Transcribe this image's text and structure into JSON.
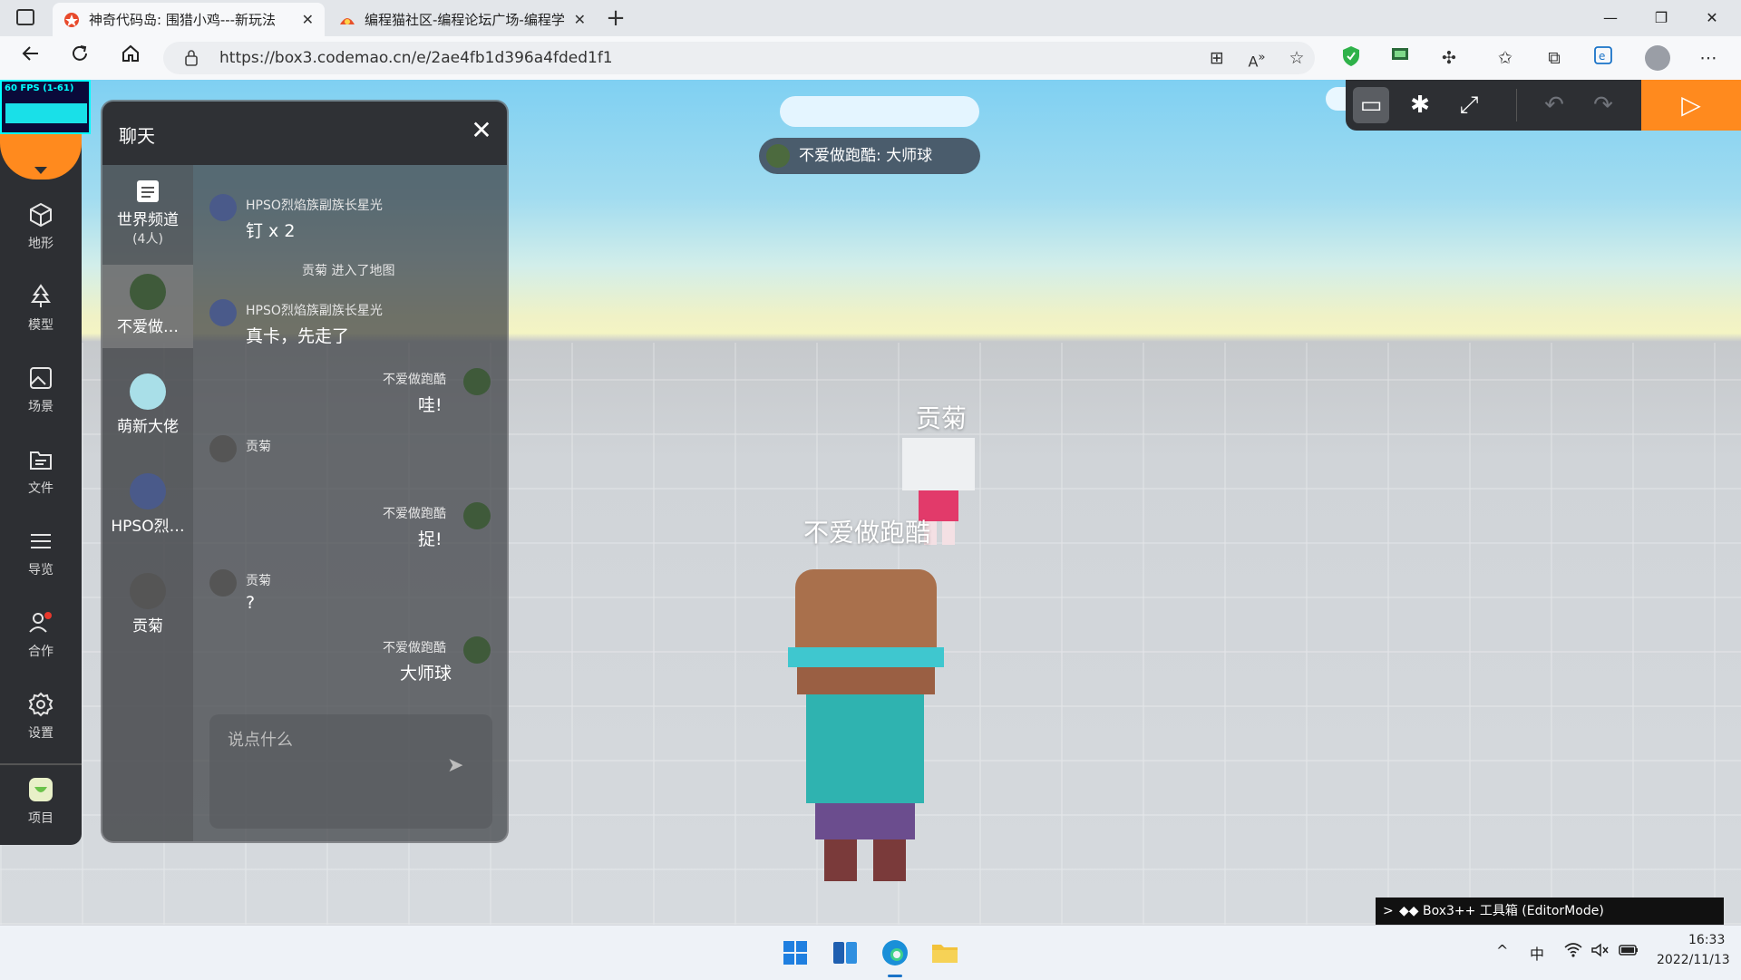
{
  "browser": {
    "tabs": [
      {
        "label": "神奇代码岛: 围猎小鸡---新玩法",
        "close": "✕",
        "icon": "codemao-island-icon"
      },
      {
        "label": "编程猫社区-编程论坛广场-编程学",
        "close": "✕",
        "icon": "codemao-community-icon"
      }
    ],
    "new_tab": "+",
    "url": "https://box3.codemao.cn/e/2ae4fb1d396a4fded1f1",
    "window_controls": {
      "minimize": "—",
      "restore": "❐",
      "close": "✕"
    }
  },
  "fps_meter": {
    "label": "60 FPS (1-61)"
  },
  "sidebar": {
    "items": [
      {
        "label": "地形",
        "icon": "cube-icon"
      },
      {
        "label": "模型",
        "icon": "tree-icon"
      },
      {
        "label": "场景",
        "icon": "image-icon"
      },
      {
        "label": "文件",
        "icon": "file-icon"
      },
      {
        "label": "导览",
        "icon": "list-icon"
      },
      {
        "label": "合作",
        "icon": "users-icon"
      },
      {
        "label": "设置",
        "icon": "gear-icon"
      },
      {
        "label": "项目",
        "icon": "project-icon"
      }
    ]
  },
  "chat": {
    "title": "聊天",
    "close": "✕",
    "channels": [
      {
        "name": "世界频道",
        "sub": "(4人)"
      },
      {
        "name": "不爱做…"
      },
      {
        "name": "萌新大佬"
      },
      {
        "name": "HPSO烈…"
      },
      {
        "name": "贡菊"
      }
    ],
    "messages": [
      {
        "sender": "HPSO烈焰族副族长星光",
        "text": "钉 x 2",
        "side": "left"
      },
      {
        "system": "贡菊 进入了地图"
      },
      {
        "sender": "HPSO烈焰族副族长星光",
        "text": "真卡，先走了",
        "side": "left"
      },
      {
        "sender": "不爱做跑酷",
        "text": "哇!",
        "side": "right"
      },
      {
        "sender": "贡菊",
        "text": "",
        "side": "left"
      },
      {
        "sender": "不爱做跑酷",
        "text": "捉!",
        "side": "right"
      },
      {
        "sender": "贡菊",
        "text": "?",
        "side": "left"
      },
      {
        "sender": "不爱做跑酷",
        "text": "大师球",
        "side": "right"
      }
    ],
    "input_placeholder": "说点什么",
    "send_icon": "➤"
  },
  "scene": {
    "badge": "不爱做跑酷: 大师球",
    "player_tags": [
      "贡菊",
      "不爱做跑酷"
    ]
  },
  "toolbar": {
    "buttons": [
      {
        "icon": "chat-icon",
        "glyph": "▭"
      },
      {
        "icon": "bug-icon",
        "glyph": "✱"
      },
      {
        "icon": "resize-icon",
        "glyph": "⤢"
      },
      {
        "icon": "undo-icon",
        "glyph": "↶"
      },
      {
        "icon": "redo-icon",
        "glyph": "↷"
      }
    ],
    "play": "▷"
  },
  "toolbox": {
    "chevron": ">",
    "label": "◆◆ Box3++ 工具箱 (EditorMode)"
  },
  "taskbar": {
    "tray": {
      "chevron": "^",
      "ime": "中"
    },
    "time": "16:33",
    "date": "2022/11/13"
  },
  "colors": {
    "accent": "#ff8a1e",
    "panel": "#2d2f33"
  }
}
